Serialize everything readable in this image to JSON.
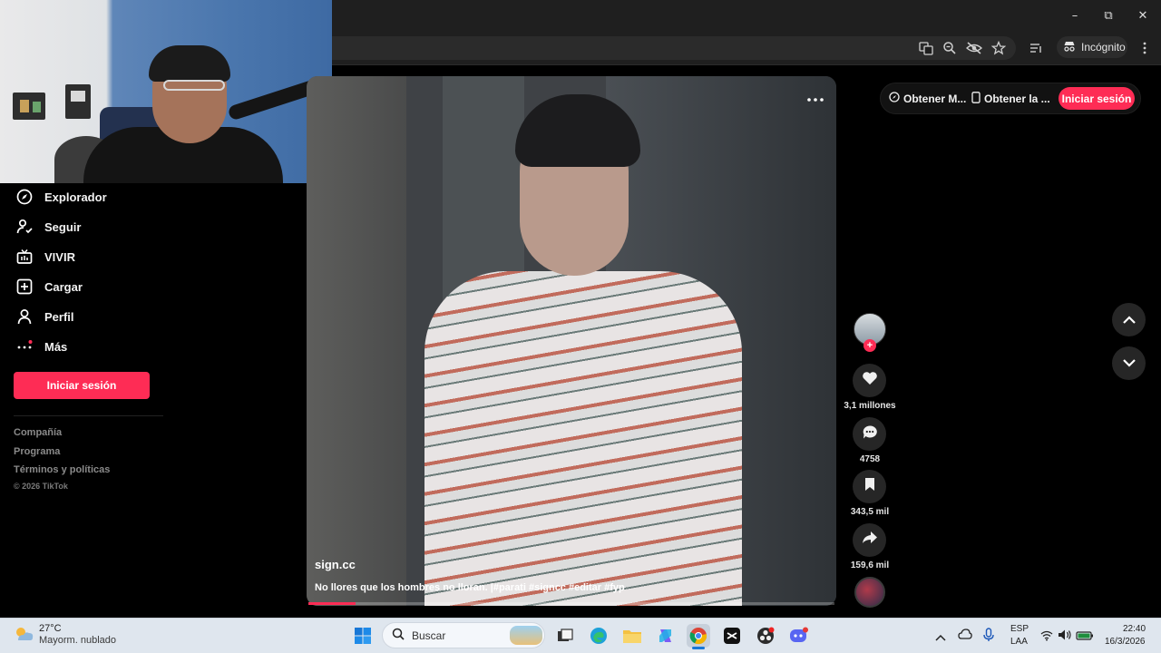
{
  "browser": {
    "incognito_label": "Incógnito",
    "window_controls": [
      "minimize-icon",
      "maximize-icon",
      "close-icon"
    ],
    "toolbar_icons": [
      "translate-icon",
      "zoom-icon",
      "eye-off-icon",
      "star-icon",
      "media-icon",
      "menu-icon"
    ]
  },
  "sidebar": {
    "items": [
      {
        "label": "Explorador",
        "icon": "compass-icon"
      },
      {
        "label": "Seguir",
        "icon": "follow-icon"
      },
      {
        "label": "VIVIR",
        "icon": "live-icon"
      },
      {
        "label": "Cargar",
        "icon": "upload-icon"
      },
      {
        "label": "Perfil",
        "icon": "person-icon"
      },
      {
        "label": "Más",
        "icon": "more-icon"
      }
    ],
    "login_label": "Iniciar sesión",
    "footer": [
      "Compañía",
      "Programa",
      "Términos y políticas",
      "© 2026 TikTok"
    ]
  },
  "video": {
    "author": "sign.cc",
    "caption": "No llores que los hombres no lloran. |#parati #signcc #editar #fyp",
    "progress": 0.09
  },
  "actions": {
    "likes": "3,1 millones",
    "comments": "4758",
    "saves": "343,5 mil",
    "shares": "159,6 mil"
  },
  "topbar": {
    "link1": "Obtener M...",
    "link2": "Obtener la ...",
    "login_label": "Iniciar sesión"
  },
  "taskbar": {
    "weather_temp": "27°C",
    "weather_desc": "Mayorm. nublado",
    "search_placeholder": "Buscar",
    "lang1": "ESP",
    "lang2": "LAA",
    "time": "22:40",
    "date": "16/3/2026"
  },
  "colors": {
    "accent": "#fe2c55",
    "taskbar": "#dfe6ee"
  }
}
